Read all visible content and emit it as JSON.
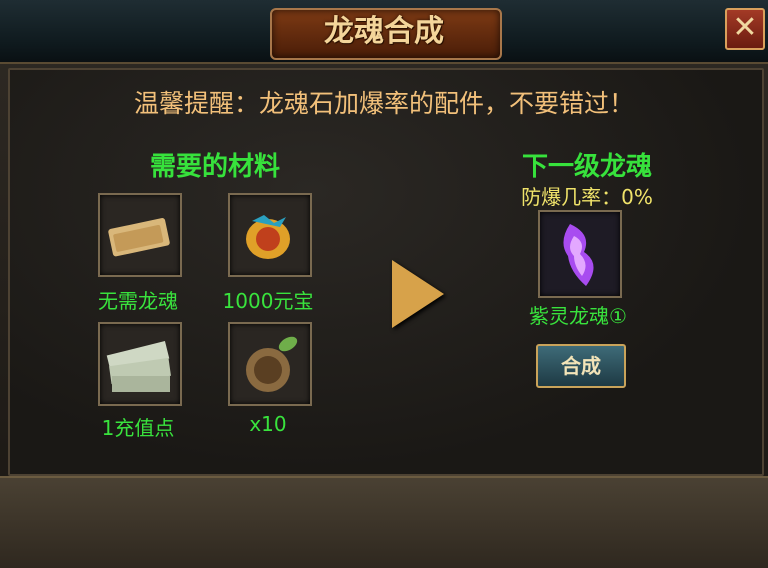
{
  "window": {
    "title": "龙魂合成",
    "close_symbol": "✕"
  },
  "tip": "温馨提醒：龙魂石加爆率的配件，不要错过！",
  "materials": {
    "title": "需要的材料",
    "items": [
      {
        "label": "无需龙魂",
        "icon": "scroll-icon"
      },
      {
        "label": "1000元宝",
        "icon": "gold-pouch-icon"
      },
      {
        "label": "1充值点",
        "icon": "banknotes-icon"
      },
      {
        "label": "x10",
        "icon": "jade-medallion-icon"
      }
    ]
  },
  "result": {
    "title": "下一级龙魂",
    "rate": "防爆几率：0%",
    "item_label": "紫灵龙魂①",
    "item_icon": "purple-dragon-soul-icon",
    "button": "合成"
  },
  "colors": {
    "green": "#37e23c",
    "gold": "#f2c07a",
    "yellow": "#f0e36a"
  }
}
